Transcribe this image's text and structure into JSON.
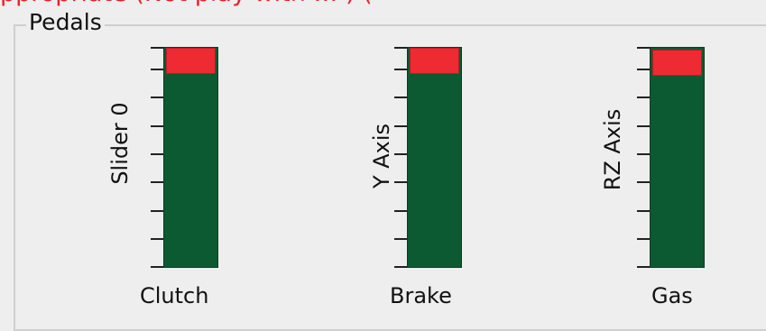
{
  "top_partial_text": "ppropriate (Not play with … ) (",
  "pedals_group": {
    "title": "Pedals",
    "axes": [
      {
        "id": "clutch",
        "axis_label": "Slider 0",
        "pedal_label": "Clutch",
        "indicator_level": 1.0
      },
      {
        "id": "brake",
        "axis_label": "Y Axis",
        "pedal_label": "Brake",
        "indicator_level": 1.0
      },
      {
        "id": "gas",
        "axis_label": "RZ Axis",
        "pedal_label": "Gas",
        "indicator_level": 1.0
      }
    ]
  },
  "colors": {
    "track": "#0b5a32",
    "indicator": "#ee2a32",
    "background": "#eeeeee"
  }
}
